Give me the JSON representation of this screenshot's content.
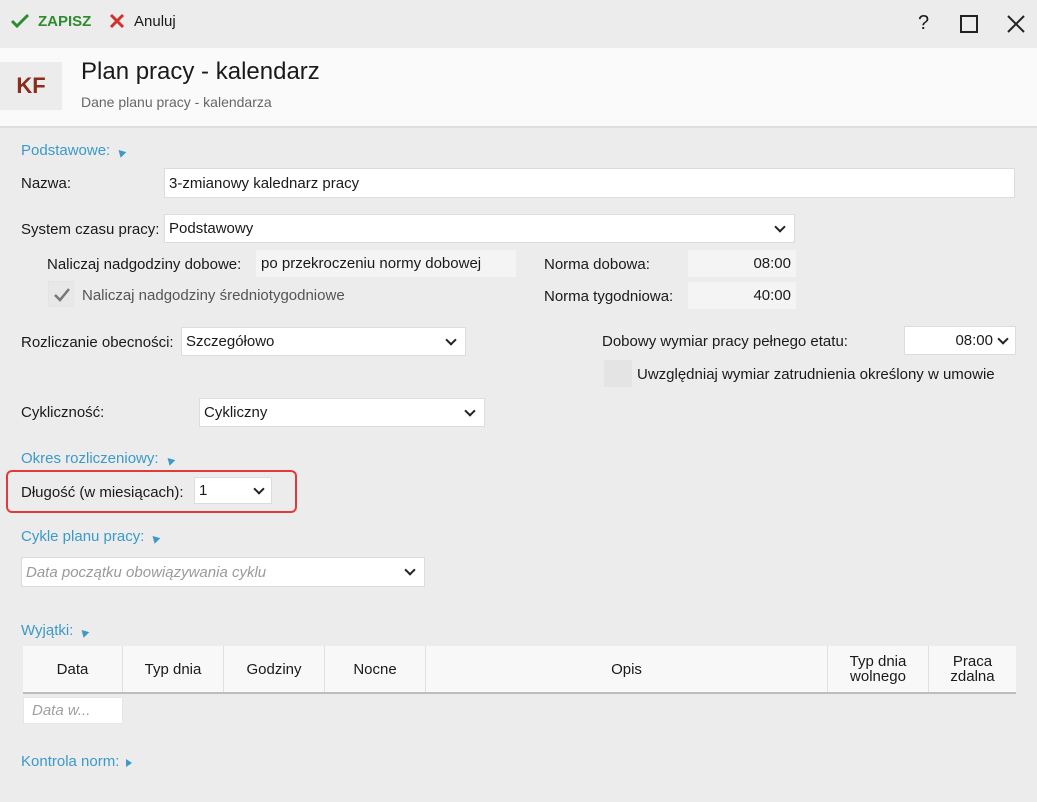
{
  "toolbar": {
    "save_label": "ZAPISZ",
    "cancel_label": "Anuluj",
    "help_label": "?"
  },
  "header": {
    "badge": "KF",
    "title": "Plan pracy - kalendarz",
    "subtitle": "Dane planu pracy - kalendarza"
  },
  "basic": {
    "section_label": "Podstawowe:",
    "name_label": "Nazwa:",
    "name_value": "3-zmianowy kalednarz pracy",
    "system_label": "System czasu pracy:",
    "system_value": "Podstawowy",
    "overtime_label": "Naliczaj nadgodziny dobowe:",
    "overtime_value": "po przekroczeniu normy dobowej",
    "weekly_overtime_label": "Naliczaj nadgodziny średniotygodniowe",
    "weekly_overtime_checked": true,
    "norm_daily_label": "Norma dobowa:",
    "norm_daily_value": "08:00",
    "norm_weekly_label": "Norma tygodniowa:",
    "norm_weekly_value": "40:00",
    "attendance_label": "Rozliczanie obecności:",
    "attendance_value": "Szczegółowo",
    "fulltime_label": "Dobowy wymiar pracy pełnego etatu:",
    "fulltime_value": "08:00",
    "contract_label": "Uwzględniaj wymiar zatrudnienia określony w umowie",
    "contract_checked": false,
    "cyclic_label": "Cykliczność:",
    "cyclic_value": "Cykliczny"
  },
  "settlement": {
    "section_label": "Okres rozliczeniowy:",
    "length_label": "Długość (w miesiącach):",
    "length_value": "1"
  },
  "cycles": {
    "section_label": "Cykle planu pracy:",
    "date_placeholder": "Data początku obowiązywania cyklu"
  },
  "exceptions": {
    "section_label": "Wyjątki:",
    "columns": [
      "Data",
      "Typ dnia",
      "Godziny",
      "Nocne",
      "Opis",
      "Typ dnia wolnego",
      "Praca zdalna"
    ],
    "filter_placeholder": "Data w..."
  },
  "norms": {
    "section_label": "Kontrola norm:"
  },
  "colors": {
    "accent": "#3b9ac9",
    "save_green": "#2e8b2e",
    "cancel_red": "#d32f2f",
    "highlight": "#e03a3a"
  }
}
